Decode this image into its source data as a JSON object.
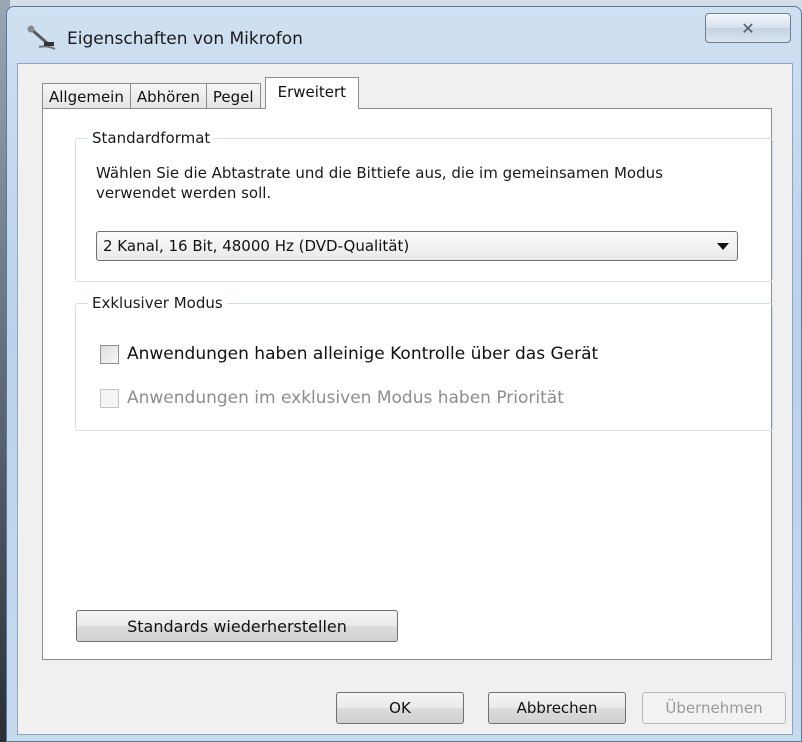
{
  "window": {
    "title": "Eigenschaften von Mikrofon",
    "title_icon": "microphone-icon",
    "close_icon": "close-icon",
    "close_label": "✕"
  },
  "tabs": [
    {
      "label": "Allgemein",
      "active": false
    },
    {
      "label": "Abhören",
      "active": false
    },
    {
      "label": "Pegel",
      "active": false
    },
    {
      "label": "Erweitert",
      "active": true
    }
  ],
  "standardformat": {
    "group_label": "Standardformat",
    "description": "Wählen Sie die Abtastrate und die Bittiefe aus, die im gemeinsamen Modus verwendet werden soll.",
    "selected_format": "2 Kanal, 16 Bit, 48000 Hz (DVD-Qualität)"
  },
  "exclusive": {
    "group_label": "Exklusiver Modus",
    "allow_exclusive_label": "Anwendungen haben alleinige Kontrolle über das Gerät",
    "allow_exclusive_checked": false,
    "priority_label": "Anwendungen im exklusiven Modus haben Priorität",
    "priority_checked": false,
    "priority_enabled": false
  },
  "buttons": {
    "restore_defaults": "Standards wiederherstellen",
    "ok": "OK",
    "cancel": "Abbrechen",
    "apply": "Übernehmen"
  }
}
